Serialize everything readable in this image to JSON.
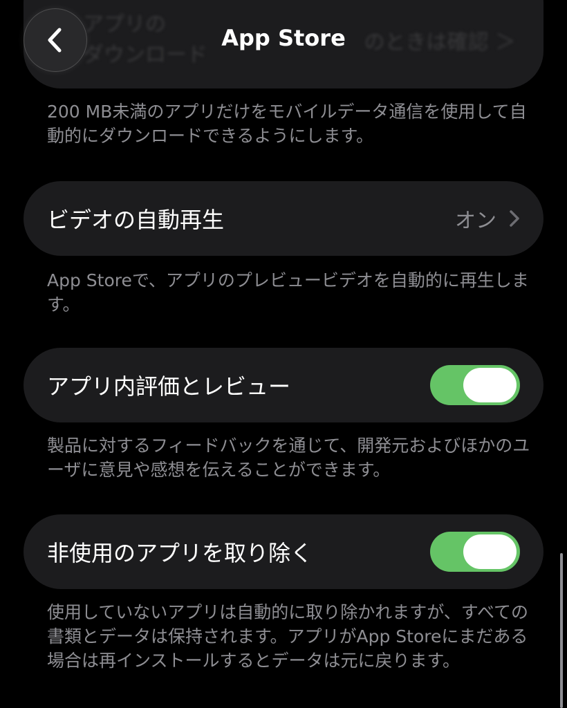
{
  "nav": {
    "title": "App Store"
  },
  "top_card": {
    "label": "アプリの\nダウンロード",
    "value": "のときは確認 ＞"
  },
  "notes": {
    "cellular_download": "200 MB未満のアプリだけをモバイルデータ通信を使用して自動的にダウンロードできるようにします。",
    "video_autoplay": "App Storeで、アプリのプレビュービデオを自動的に再生します。",
    "ratings_reviews": "製品に対するフィードバックを通じて、開発元およびほかのユーザに意見や感想を伝えることができます。",
    "offload_apps": "使用していないアプリは自動的に取り除かれますが、すべての書類とデータは保持されます。アプリがApp Storeにまだある場合は再インストールするとデータは元に戻ります。"
  },
  "rows": {
    "video_autoplay": {
      "label": "ビデオの自動再生",
      "value": "オン"
    },
    "ratings_reviews": {
      "label": "アプリ内評価とレビュー",
      "state": "on"
    },
    "offload_apps": {
      "label": "非使用のアプリを取り除く",
      "state": "on"
    }
  },
  "colors": {
    "toggle_on": "#65c466",
    "card_bg": "#1c1c1e",
    "secondary_text": "#8e8e93"
  },
  "icons": {
    "back": "chevron-left-icon",
    "disclosure": "chevron-right-icon"
  }
}
